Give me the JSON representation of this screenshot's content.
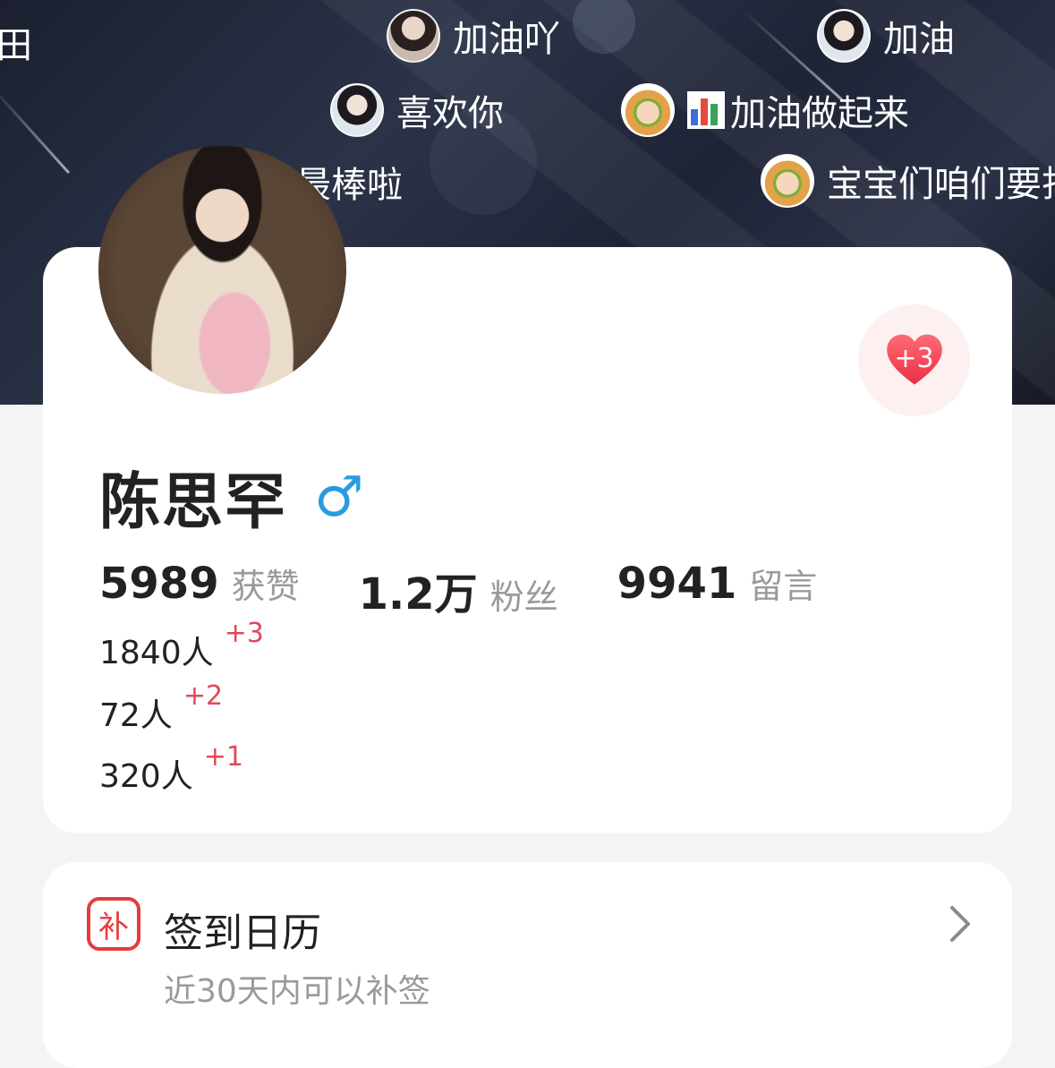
{
  "banner": {
    "danmu": [
      {
        "text": "田",
        "avatar": "none"
      },
      {
        "text": "加油吖",
        "avatar": "boy-avatar"
      },
      {
        "text": "加油",
        "avatar": "boy-avatar"
      },
      {
        "text": "喜欢你",
        "avatar": "boy-avatar"
      },
      {
        "text": "加油做起来",
        "avatar": "burger-avatar",
        "prefix_icon": "bar-chart-emoji"
      },
      {
        "text": "最棒啦",
        "avatar": "none"
      },
      {
        "text": "宝宝们咱们要打",
        "avatar": "burger-avatar"
      }
    ]
  },
  "profile": {
    "name": "陈思罕",
    "gender_symbol": "♂",
    "like_button": {
      "count": "+3",
      "icon": "heart-icon",
      "color": "#f0404f"
    },
    "stats": [
      {
        "value": "5989",
        "label": "获赞"
      },
      {
        "value": "1.2万",
        "label": "粉丝"
      },
      {
        "value": "9941",
        "label": "留言"
      }
    ],
    "sub_rows": [
      {
        "text": "1840人",
        "plus": "+3"
      },
      {
        "text": "72人",
        "plus": "+2"
      },
      {
        "text": "320人",
        "plus": "+1"
      }
    ]
  },
  "calendar": {
    "icon_char": "补",
    "title": "签到日历",
    "subtitle": "近30天内可以补签",
    "accent": "#e63b3b"
  }
}
